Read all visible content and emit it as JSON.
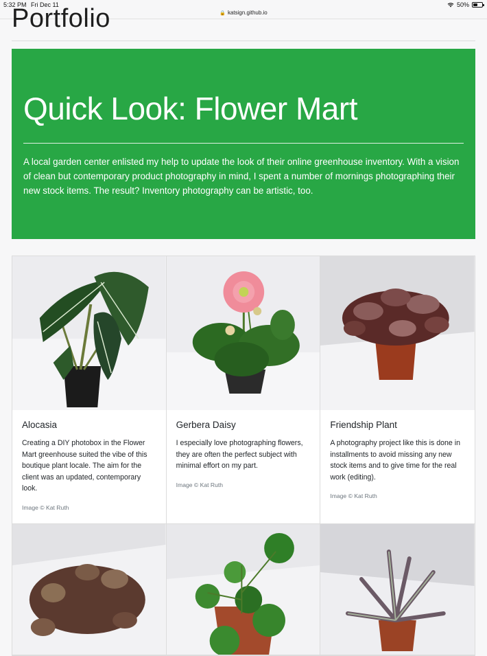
{
  "status": {
    "time": "5:32 PM",
    "date": "Fri Dec 11",
    "battery": "50%",
    "url": "katsign.github.io"
  },
  "page": {
    "portfolio_title": "Portfolio"
  },
  "hero": {
    "title": "Quick Look: Flower Mart",
    "description": "A local garden center enlisted my help to update the look of their online greenhouse inventory. With a vision of clean but contemporary product photography in mind, I spent a number of mornings photographing their new stock items. The result? Inventory photography can be artistic, too.",
    "color": "#28a745"
  },
  "cards": [
    {
      "title": "Alocasia",
      "text": "Creating a DIY photobox in the Flower Mart greenhouse suited the vibe of this boutique plant locale. The aim for the client was an updated, contemporary look.",
      "credit": "Image © Kat Ruth"
    },
    {
      "title": "Gerbera Daisy",
      "text": "I especially love photographing flowers, they are often the perfect subject with minimal effort on my part.",
      "credit": "Image © Kat Ruth"
    },
    {
      "title": "Friendship Plant",
      "text": "A photography project like this is done in installments to avoid missing any new stock items and to give time for the real work (editing).",
      "credit": "Image © Kat Ruth"
    }
  ]
}
